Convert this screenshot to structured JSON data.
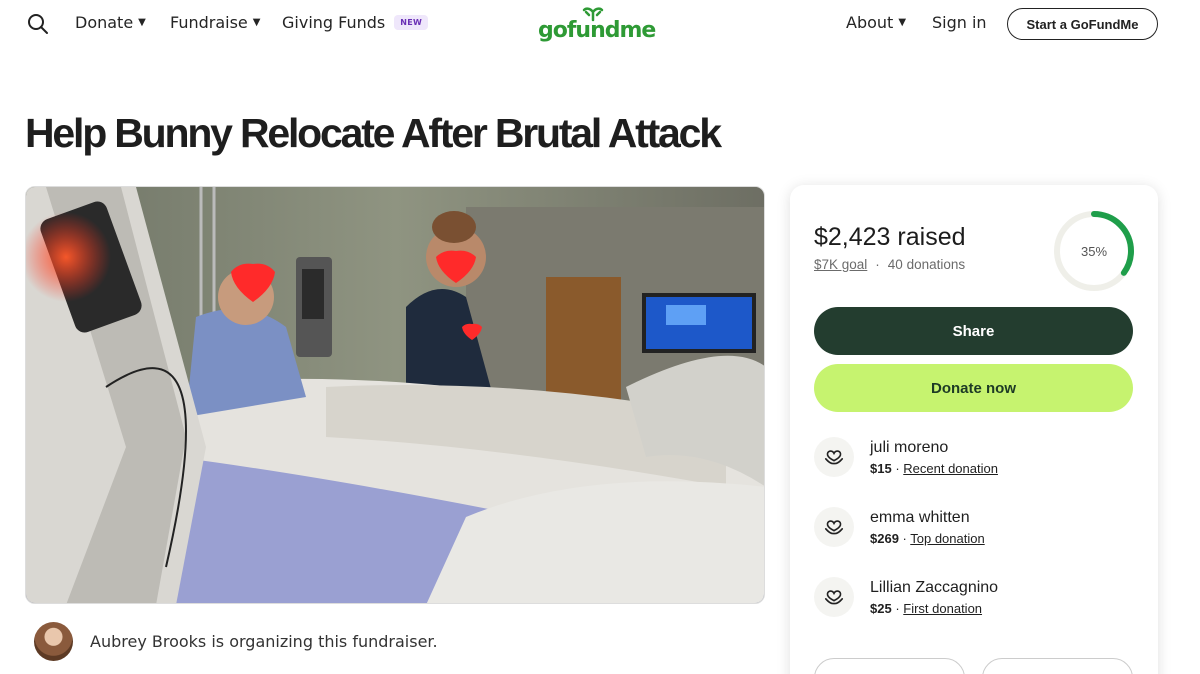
{
  "header": {
    "search_icon": "search-icon",
    "nav_left": [
      {
        "label": "Donate"
      },
      {
        "label": "Fundraise"
      },
      {
        "label": "Giving Funds",
        "badge": "NEW"
      }
    ],
    "logo": "gofundme",
    "nav_right": [
      {
        "label": "About"
      },
      {
        "label": "Sign in"
      }
    ],
    "cta": "Start a GoFundMe"
  },
  "campaign": {
    "title": "Help Bunny Relocate After Brutal Attack",
    "organizer_text": "Aubrey Brooks is organizing this fundraiser."
  },
  "panel": {
    "raised": "$2,423 raised",
    "goal": "$7K goal",
    "separator": "·",
    "donations": "40 donations",
    "progress_percent": 35,
    "progress_label": "35%",
    "share_label": "Share",
    "donate_label": "Donate now",
    "donors": [
      {
        "name": "juli moreno",
        "amount": "$15",
        "type": "Recent donation"
      },
      {
        "name": "emma whitten",
        "amount": "$269",
        "type": "Top donation"
      },
      {
        "name": "Lillian Zaccagnino",
        "amount": "$25",
        "type": "First donation"
      }
    ]
  },
  "colors": {
    "brand_green": "#2e9a35",
    "share_bg": "#233d2f",
    "donate_bg": "#c6f36f",
    "progress_ring": "#1f9e4a",
    "new_badge": "#6a2fb5"
  }
}
